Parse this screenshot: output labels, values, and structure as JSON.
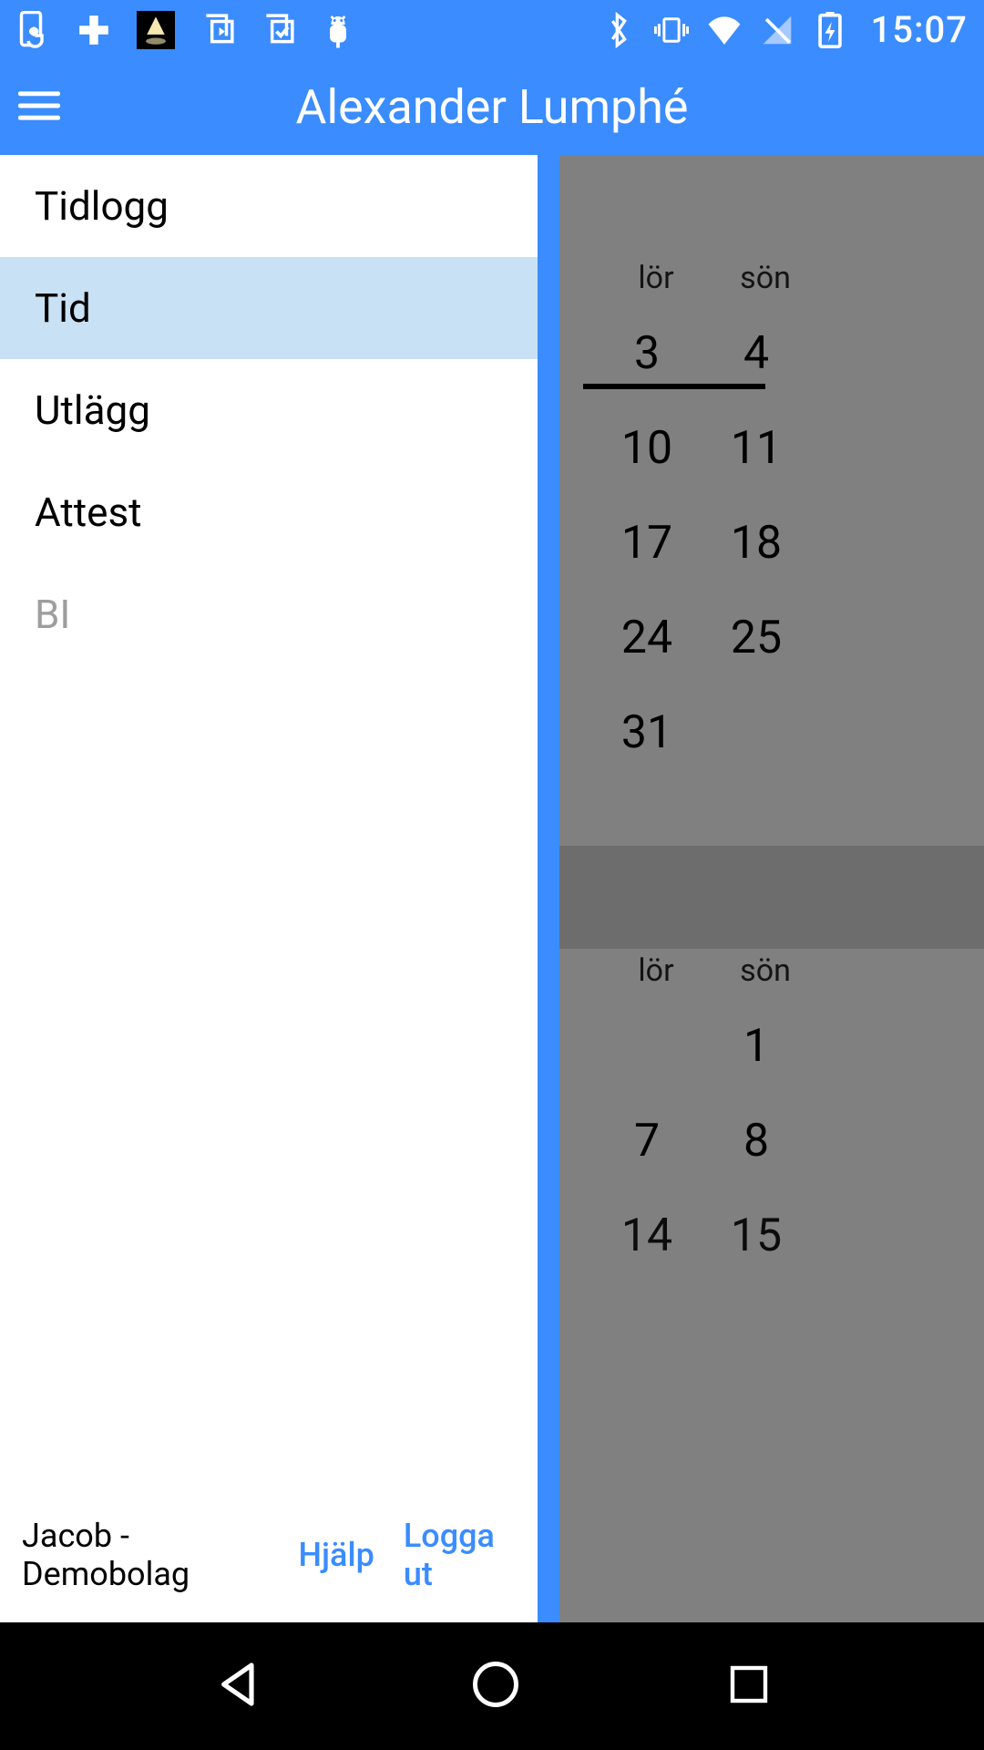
{
  "status": {
    "time": "15:07"
  },
  "header": {
    "title": "Alexander Lumphé"
  },
  "drawer": {
    "items": [
      {
        "label": "Tidlogg"
      },
      {
        "label": "Tid"
      },
      {
        "label": "Utlägg"
      },
      {
        "label": "Attest"
      },
      {
        "label": "BI"
      }
    ],
    "user": "Jacob - Demobolag",
    "help": "Hjälp",
    "logout": "Logga ut"
  },
  "calendar": {
    "day_sat": "lör",
    "day_sun": "sön",
    "month1_rows": [
      [
        "3",
        "4"
      ],
      [
        "10",
        "11"
      ],
      [
        "17",
        "18"
      ],
      [
        "24",
        "25"
      ],
      [
        "31",
        ""
      ]
    ],
    "month2_rows": [
      [
        "",
        "1"
      ],
      [
        "7",
        "8"
      ],
      [
        "14",
        "15"
      ]
    ]
  },
  "colors": {
    "primary": "#3a8cff",
    "selected": "#c9e1f5"
  }
}
